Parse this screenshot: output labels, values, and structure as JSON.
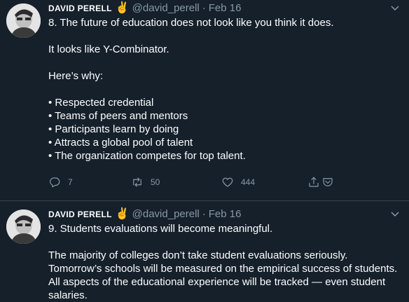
{
  "tweets": [
    {
      "name": "DAVID PERELL",
      "emoji": "✌",
      "handle": "@david_perell",
      "separator": "·",
      "date": "Feb 16",
      "lines": [
        "8. The future of education does not look like you think it does.",
        "",
        "It looks like Y-Combinator.",
        "",
        "Here’s why:",
        "",
        "• Respected credential",
        "• Teams of peers and mentors",
        "• Participants learn by doing",
        "• Attracts a global pool of talent",
        "• The organization competes for top talent."
      ],
      "actions": {
        "reply_count": "7",
        "retweet_count": "50",
        "like_count": "444"
      }
    },
    {
      "name": "DAVID PERELL",
      "emoji": "✌",
      "handle": "@david_perell",
      "separator": "·",
      "date": "Feb 16",
      "lines": [
        "9. Students evaluations will become meaningful.",
        "",
        "The majority of colleges don’t take student evaluations seriously. Tomorrow’s schools will be measured on the empirical success of students. All aspects of the educational experience will be tracked — even student salaries."
      ]
    }
  ],
  "icons": {
    "reply": "reply-icon",
    "retweet": "retweet-icon",
    "like": "heart-icon",
    "share": "share-icon",
    "more": "chevron-down-icon"
  },
  "colors": {
    "background": "#15202b",
    "muted": "#8899a6",
    "divider": "#38444d",
    "text": "#ffffff"
  }
}
